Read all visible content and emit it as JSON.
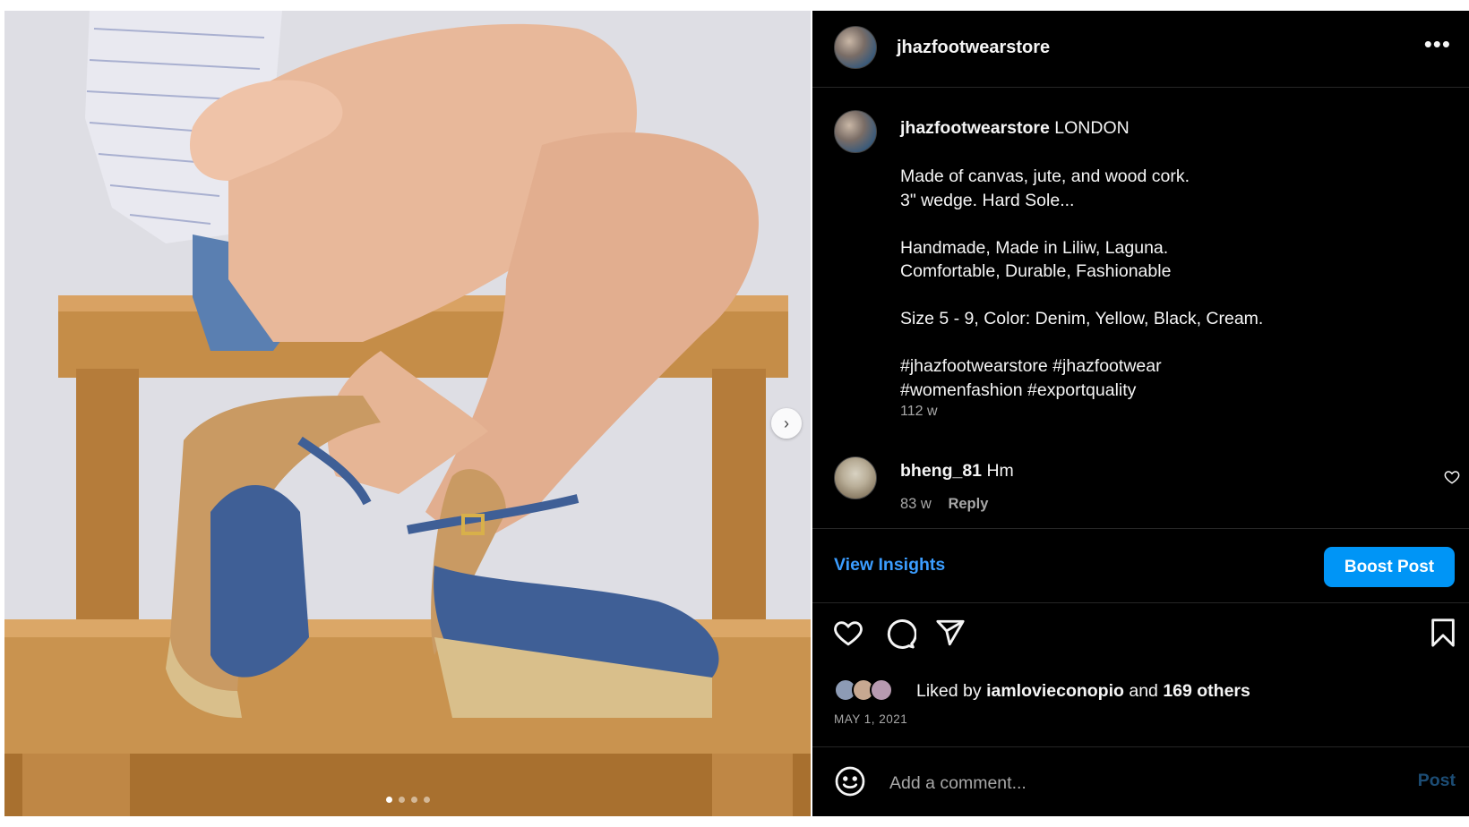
{
  "post": {
    "image": {
      "alt_description": "",
      "carousel_dots": 4,
      "active_dot": 0
    },
    "header": {
      "username": "jhazfootwearstore",
      "more_icon": "more-horizontal-icon"
    },
    "caption": {
      "username": "jhazfootwearstore",
      "location": "LONDON",
      "lines": [
        "Made of canvas, jute, and wood cork.",
        "3\" wedge. Hard Sole...",
        "Handmade, Made in Liliw, Laguna.",
        "Comfortable, Durable, Fashionable",
        "Size 5 - 9, Color: Denim, Yellow, Black, Cream.",
        "#jhazfootwearstore #jhazfootwear",
        "#womenfashion #exportquality"
      ],
      "time": "112 w"
    },
    "comment": {
      "username": "bheng_81",
      "text": "Hm",
      "time": "83 w",
      "reply_label": "Reply"
    },
    "insights": {
      "view_label": "View Insights",
      "boost_label": "Boost Post"
    },
    "likes": {
      "prefix": "Liked by",
      "user": "iamlovieconopio",
      "joiner": "and",
      "others": "169 others"
    },
    "date": "MAY 1, 2021",
    "add_comment": {
      "placeholder": "Add a comment...",
      "post_label": "Post"
    }
  },
  "colors": {
    "panel_bg": "#000000",
    "accent_blue": "#0095f6",
    "link_blue": "#3b9dff",
    "muted_text": "#a8a8a8"
  }
}
